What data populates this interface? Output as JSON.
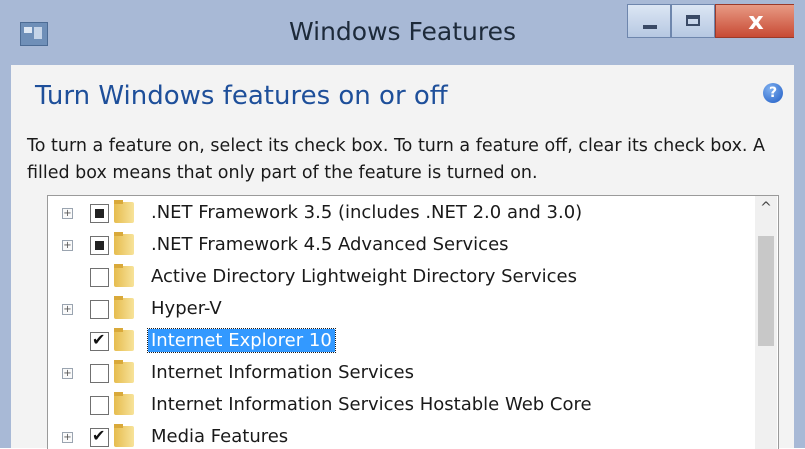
{
  "window": {
    "title": "Windows Features",
    "close_glyph": "x"
  },
  "content": {
    "heading": "Turn Windows features on or off",
    "help_glyph": "?",
    "description": "To turn a feature on, select its check box. To turn a feature off, clear its check box. A filled box means that only part of the feature is turned on."
  },
  "features": [
    {
      "label": ".NET Framework 3.5 (includes .NET 2.0 and 3.0)",
      "state": "partial",
      "expandable": true,
      "selected": false
    },
    {
      "label": ".NET Framework 4.5 Advanced Services",
      "state": "partial",
      "expandable": true,
      "selected": false
    },
    {
      "label": "Active Directory Lightweight Directory Services",
      "state": "unchecked",
      "expandable": false,
      "selected": false
    },
    {
      "label": "Hyper-V",
      "state": "unchecked",
      "expandable": true,
      "selected": false
    },
    {
      "label": "Internet Explorer 10",
      "state": "checked",
      "expandable": false,
      "selected": true
    },
    {
      "label": "Internet Information Services",
      "state": "unchecked",
      "expandable": true,
      "selected": false
    },
    {
      "label": "Internet Information Services Hostable Web Core",
      "state": "unchecked",
      "expandable": false,
      "selected": false
    },
    {
      "label": "Media Features",
      "state": "checked",
      "expandable": true,
      "selected": false
    }
  ],
  "icons": {
    "app": "windows-features-icon",
    "folder": "folder-icon",
    "expander": "plus-icon"
  },
  "colors": {
    "heading": "#1e4f9a",
    "selection": "#3399ff",
    "close_button": "#c84a34"
  }
}
